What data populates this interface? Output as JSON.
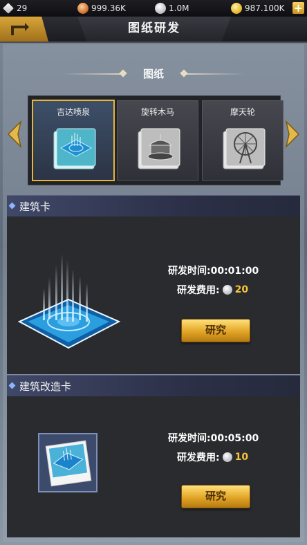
{
  "resources": {
    "gems": "29",
    "copper": "999.36K",
    "silver": "1.0M",
    "gold": "987.100K"
  },
  "header": {
    "title": "图纸研发"
  },
  "blueprints": {
    "section_title": "图纸",
    "items": [
      {
        "name": "吉达喷泉",
        "selected": true
      },
      {
        "name": "旋转木马",
        "selected": false
      },
      {
        "name": "摩天轮",
        "selected": false
      }
    ]
  },
  "building_card": {
    "header": "建筑卡",
    "time": "研发时间:00:01:00",
    "cost_label": "研发费用:",
    "cost_amount": "20",
    "button": "研究"
  },
  "upgrade_card": {
    "header": "建筑改造卡",
    "time": "研发时间:00:05:00",
    "cost_label": "研发费用:",
    "cost_amount": "10",
    "button": "研究"
  },
  "colors": {
    "accent_gold": "#e7b53a",
    "cost_amount": "#f6c23c",
    "header_blue": "#404868"
  }
}
